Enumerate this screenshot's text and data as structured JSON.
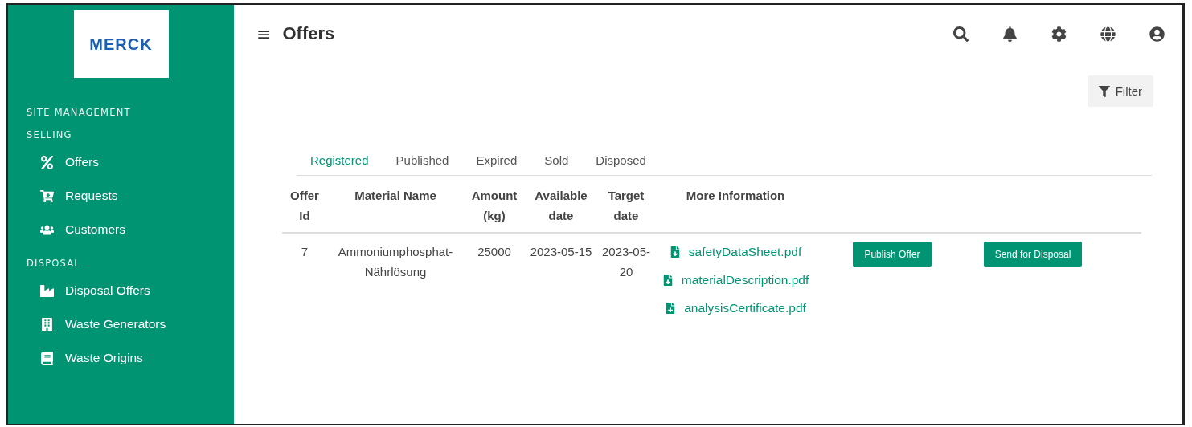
{
  "sidebar": {
    "logo": "MERCK",
    "sections": [
      {
        "title": "SITE MANAGEMENT"
      },
      {
        "title": "SELLING",
        "items": [
          {
            "label": "Offers"
          },
          {
            "label": "Requests"
          },
          {
            "label": "Customers"
          }
        ]
      },
      {
        "title": "DISPOSAL",
        "items": [
          {
            "label": "Disposal Offers"
          },
          {
            "label": "Waste Generators"
          },
          {
            "label": "Waste Origins"
          }
        ]
      }
    ]
  },
  "header": {
    "menu": "≡",
    "title": "Offers"
  },
  "filter_button": "Filter",
  "tabs": [
    {
      "label": "Registered",
      "selected": true
    },
    {
      "label": "Published",
      "selected": false
    },
    {
      "label": "Expired",
      "selected": false
    },
    {
      "label": "Sold",
      "selected": false
    },
    {
      "label": "Disposed",
      "selected": false
    }
  ],
  "table": {
    "columns": [
      "Offer Id",
      "Material Name",
      "Amount (kg)",
      "Available date",
      "Target date",
      "More Information"
    ],
    "rows": [
      {
        "cells": [
          "7",
          "Ammoniumphosphat-Nährlösung",
          "25000",
          "2023-05-15",
          "2023-05-20"
        ],
        "files": [
          "safetyDataSheet.pdf",
          "materialDescription.pdf",
          "analysisCertificate.pdf"
        ],
        "buttons": [
          "Publish Offer",
          "Send for Disposal"
        ]
      }
    ]
  }
}
